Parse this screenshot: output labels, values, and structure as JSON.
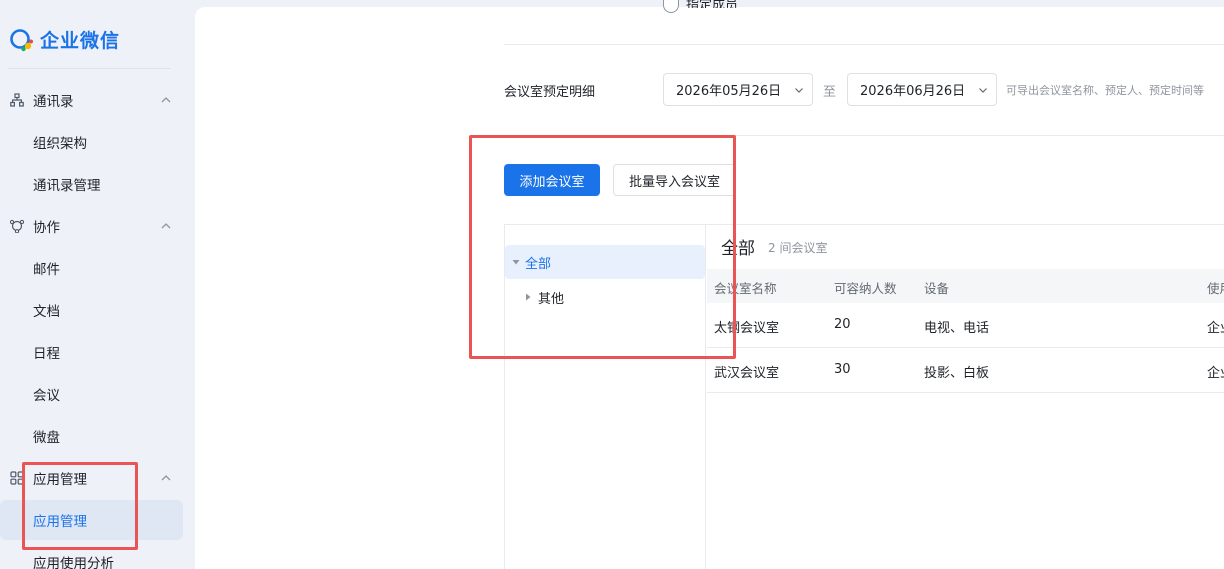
{
  "brand": {
    "name": "企业微信"
  },
  "sidebar": {
    "groups": [
      {
        "label": "通讯录",
        "items": [
          {
            "label": "组织架构"
          },
          {
            "label": "通讯录管理"
          }
        ]
      },
      {
        "label": "协作",
        "items": [
          {
            "label": "邮件"
          },
          {
            "label": "文档"
          },
          {
            "label": "日程"
          },
          {
            "label": "会议"
          },
          {
            "label": "微盘"
          }
        ]
      },
      {
        "label": "应用管理",
        "items": [
          {
            "label": "应用管理"
          },
          {
            "label": "应用使用分析"
          }
        ]
      }
    ],
    "active_item": "应用管理"
  },
  "booking": {
    "top_option": "指定成员",
    "detail_label": "会议室预定明细",
    "start_date": "2026年05月26日",
    "to_text": "至",
    "end_date": "2026年06月26日",
    "hint": "可导出会议室名称、预定人、预定时间等"
  },
  "actions": {
    "add_room": "添加会议室",
    "batch_import": "批量导入会议室"
  },
  "tree": {
    "nodes": [
      {
        "label": "全部",
        "expanded": true,
        "selected": true
      },
      {
        "label": "其他",
        "expanded": false,
        "selected": false
      }
    ]
  },
  "table": {
    "title": "全部",
    "count": "2 间会议室",
    "columns": [
      "会议室名称",
      "可容纳人数",
      "设备",
      "使用"
    ],
    "rows": [
      [
        "太钢会议室",
        "20",
        "电视、电话",
        "企业"
      ],
      [
        "武汉会议室",
        "30",
        "投影、白板",
        "企业"
      ]
    ]
  },
  "colors": {
    "accent": "#1a73e8",
    "highlight": "#ea5455"
  }
}
